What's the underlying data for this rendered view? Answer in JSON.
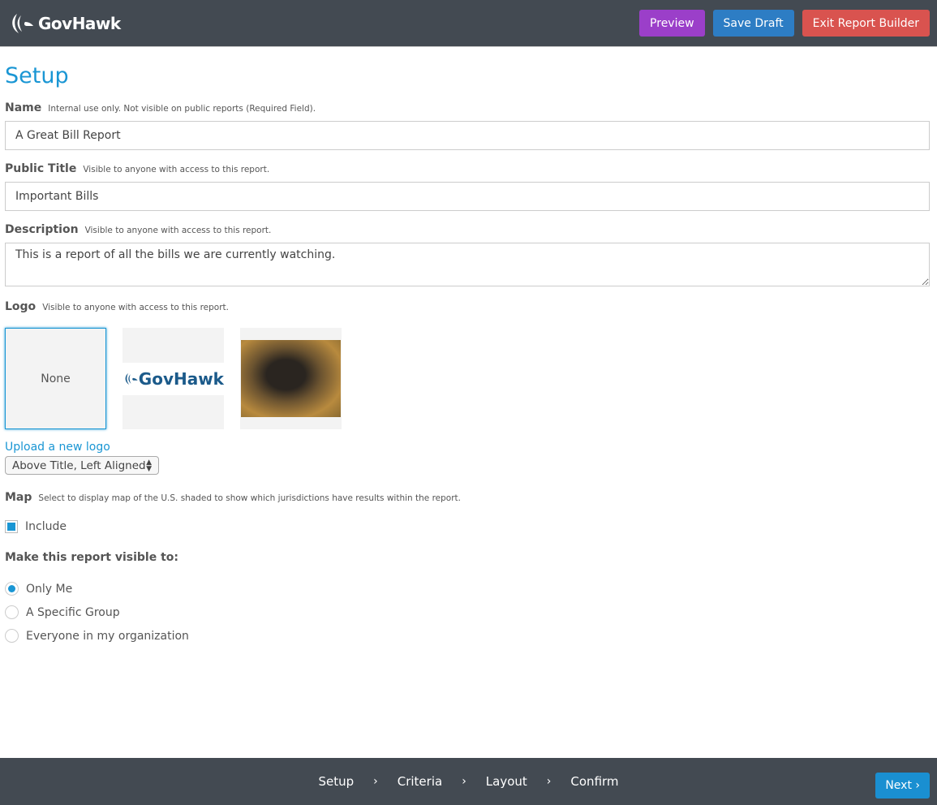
{
  "header": {
    "brand": "GovHawk",
    "preview": "Preview",
    "save_draft": "Save Draft",
    "exit": "Exit Report Builder"
  },
  "page_title": "Setup",
  "name": {
    "label": "Name",
    "hint": "Internal use only. Not visible on public reports (Required Field).",
    "value": "A Great Bill Report"
  },
  "public_title": {
    "label": "Public Title",
    "hint": "Visible to anyone with access to this report.",
    "value": "Important Bills"
  },
  "description": {
    "label": "Description",
    "hint": "Visible to anyone with access to this report.",
    "value": "This is a report of all the bills we are currently watching."
  },
  "logo": {
    "label": "Logo",
    "hint": "Visible to anyone with access to this report.",
    "options": [
      "None",
      "GovHawk",
      "honey-badger-photo"
    ],
    "selected": "None",
    "upload": "Upload a new logo",
    "position": "Above Title, Left Aligned"
  },
  "map": {
    "label": "Map",
    "hint": "Select to display map of the U.S. shaded to show which jurisdictions have results within the report.",
    "include": "Include",
    "checked": true
  },
  "visibility": {
    "label": "Make this report visible to:",
    "options": [
      "Only Me",
      "A Specific Group",
      "Everyone in my organization"
    ],
    "selected": "Only Me"
  },
  "footer": {
    "steps": [
      "Setup",
      "Criteria",
      "Layout",
      "Confirm"
    ],
    "next": "Next ›"
  },
  "colors": {
    "accent": "#1a96d4",
    "topbar": "#434a52",
    "preview": "#9b3fc9",
    "save": "#2d7dc4",
    "exit": "#d9534f"
  }
}
